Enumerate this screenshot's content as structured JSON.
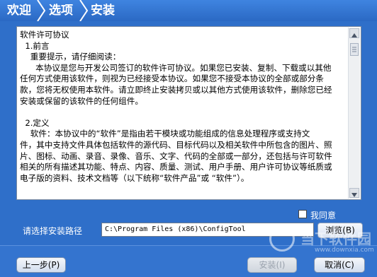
{
  "breadcrumb": {
    "step1": "欢迎",
    "step2": "选项",
    "step3": "安装"
  },
  "license": {
    "lines": [
      "软件许可协议",
      "  1.前言",
      "    重要提示，请仔细阅读：",
      "      本协议是您与开发公司签订的软件许可协议。如果您已安装、复制、下载或以其他",
      "任何方式使用该软件，则视为已经接受本协议。如果您不接受本协议的全部或部分条",
      "款，您将无权使用本软件。请立即终止安装拷贝或以其他方式使用该软件，删除您已经",
      "安装或保留的该软件的任何组件。",
      "",
      "  2.定义",
      "    软件：本协议中的“软件”是指由若干模块或功能组成的信息处理程序或支持文",
      "件，其中支持文件具体包括软件的源代码、目标代码以及相关软件中所包含的图片、照",
      "片、图标、动画、录音、录像、音乐、文字、代码的全部或一部分，还包括与许可软件",
      "相关的所有描述其功能、特点、内容、质量、测试、用户手册、用户许可协议等纸质或",
      "电子版的资料、技术文档等（以下统称“软件产品”或 “软件”）。"
    ]
  },
  "agree_label": "我同意",
  "path": {
    "label": "请选择安装路径",
    "value": "C:\\Program Files (x86)\\ConfigTool",
    "browse_label": "浏览(B)"
  },
  "buttons": {
    "prev": "上一步(P)",
    "install": "安装(I)",
    "cancel": "取消(C)"
  },
  "watermark": {
    "text": "当下软件园",
    "url": "www.downxia.com"
  },
  "colors": {
    "background": "#2f6fc9",
    "topbar": "#3478d4",
    "text": "#ffffff"
  }
}
